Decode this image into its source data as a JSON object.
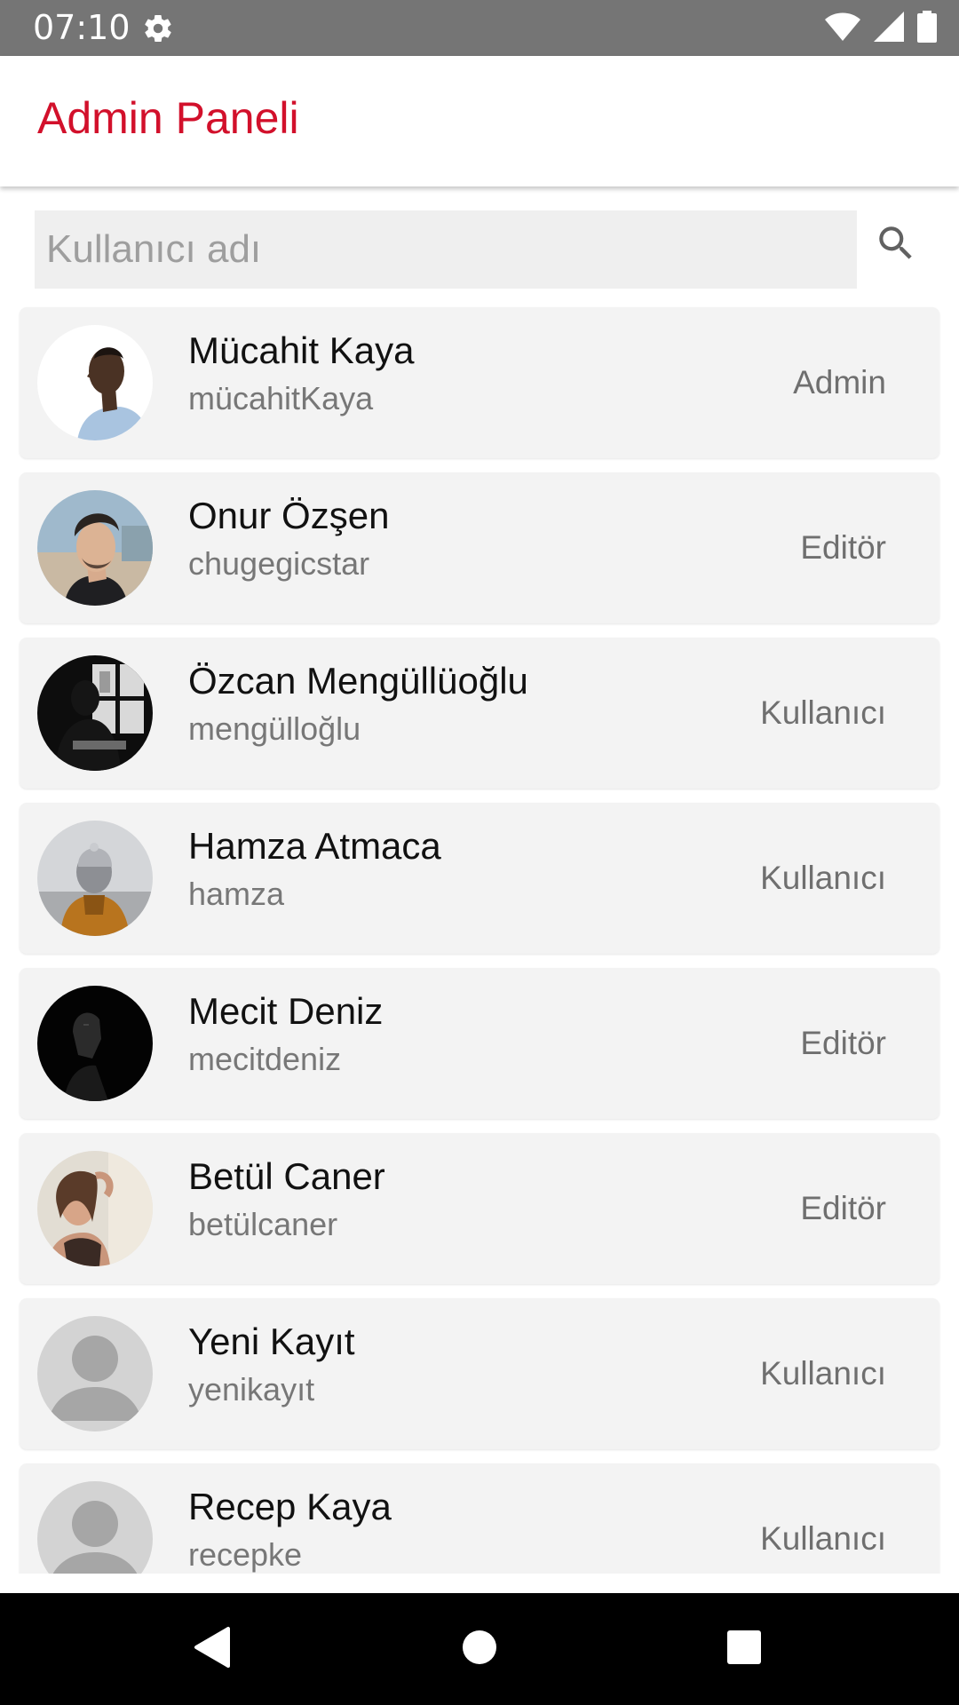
{
  "status_bar": {
    "time": "07:10",
    "icons": [
      "gear-icon",
      "wifi-icon",
      "signal-icon",
      "battery-icon"
    ]
  },
  "app_bar": {
    "title": "Admin Paneli",
    "title_color": "#d2102b"
  },
  "search": {
    "placeholder": "Kullanıcı adı",
    "value": "",
    "icon": "search-icon"
  },
  "users": [
    {
      "name": "Mücahit Kaya",
      "username": "mücahitKaya",
      "role": "Admin",
      "avatar": "photo-man-profile"
    },
    {
      "name": "Onur Özşen",
      "username": "chugegicstar",
      "role": "Editör",
      "avatar": "photo-man-beard"
    },
    {
      "name": "Özcan Mengüllüoğlu",
      "username": "mengülloğlu",
      "role": "Kullanıcı",
      "avatar": "photo-silhouette-window"
    },
    {
      "name": "Hamza Atmaca",
      "username": "hamza",
      "role": "Kullanıcı",
      "avatar": "photo-man-beanie"
    },
    {
      "name": "Mecit Deniz",
      "username": "mecitdeniz",
      "role": "Editör",
      "avatar": "photo-dark-portrait"
    },
    {
      "name": "Betül Caner",
      "username": "betülcaner",
      "role": "Editör",
      "avatar": "photo-woman"
    },
    {
      "name": "Yeni Kayıt",
      "username": "yenikayıt",
      "role": "Kullanıcı",
      "avatar": "default-avatar-icon"
    },
    {
      "name": "Recep Kaya",
      "username": "recepke",
      "role": "Kullanıcı",
      "avatar": "default-avatar-icon"
    }
  ],
  "nav_bar": {
    "buttons": [
      "back-icon",
      "home-icon",
      "recents-icon"
    ]
  }
}
